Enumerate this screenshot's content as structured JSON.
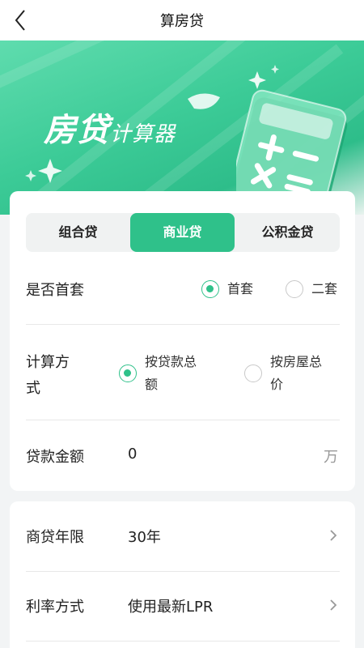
{
  "nav": {
    "title": "算房贷",
    "back_icon": "chevron-left-icon"
  },
  "banner": {
    "title_big": "房贷",
    "title_small": "计算器",
    "illustration": "calculator-icon"
  },
  "tabs": [
    {
      "label": "组合贷",
      "active": false
    },
    {
      "label": "商业贷",
      "active": true
    },
    {
      "label": "公积金贷",
      "active": false
    }
  ],
  "first_home": {
    "label": "是否首套",
    "options": [
      {
        "label": "首套",
        "selected": true
      },
      {
        "label": "二套",
        "selected": false
      }
    ]
  },
  "calc_method": {
    "label": "计算方式",
    "label_lines": [
      "计算方",
      "式"
    ],
    "options": [
      {
        "label": "按贷款总额",
        "lines": [
          "按贷款总",
          "额"
        ],
        "selected": true
      },
      {
        "label": "按房屋总价",
        "lines": [
          "按房屋总",
          "价"
        ],
        "selected": false
      }
    ]
  },
  "loan_amount": {
    "label": "贷款金额",
    "value": "0",
    "unit": "万"
  },
  "settings": [
    {
      "label": "商贷年限",
      "value": "30年"
    },
    {
      "label": "利率方式",
      "value": "使用最新LPR"
    }
  ],
  "colors": {
    "accent": "#2fc18a",
    "banner": "#3ccb97",
    "background": "#f2f4f5"
  }
}
